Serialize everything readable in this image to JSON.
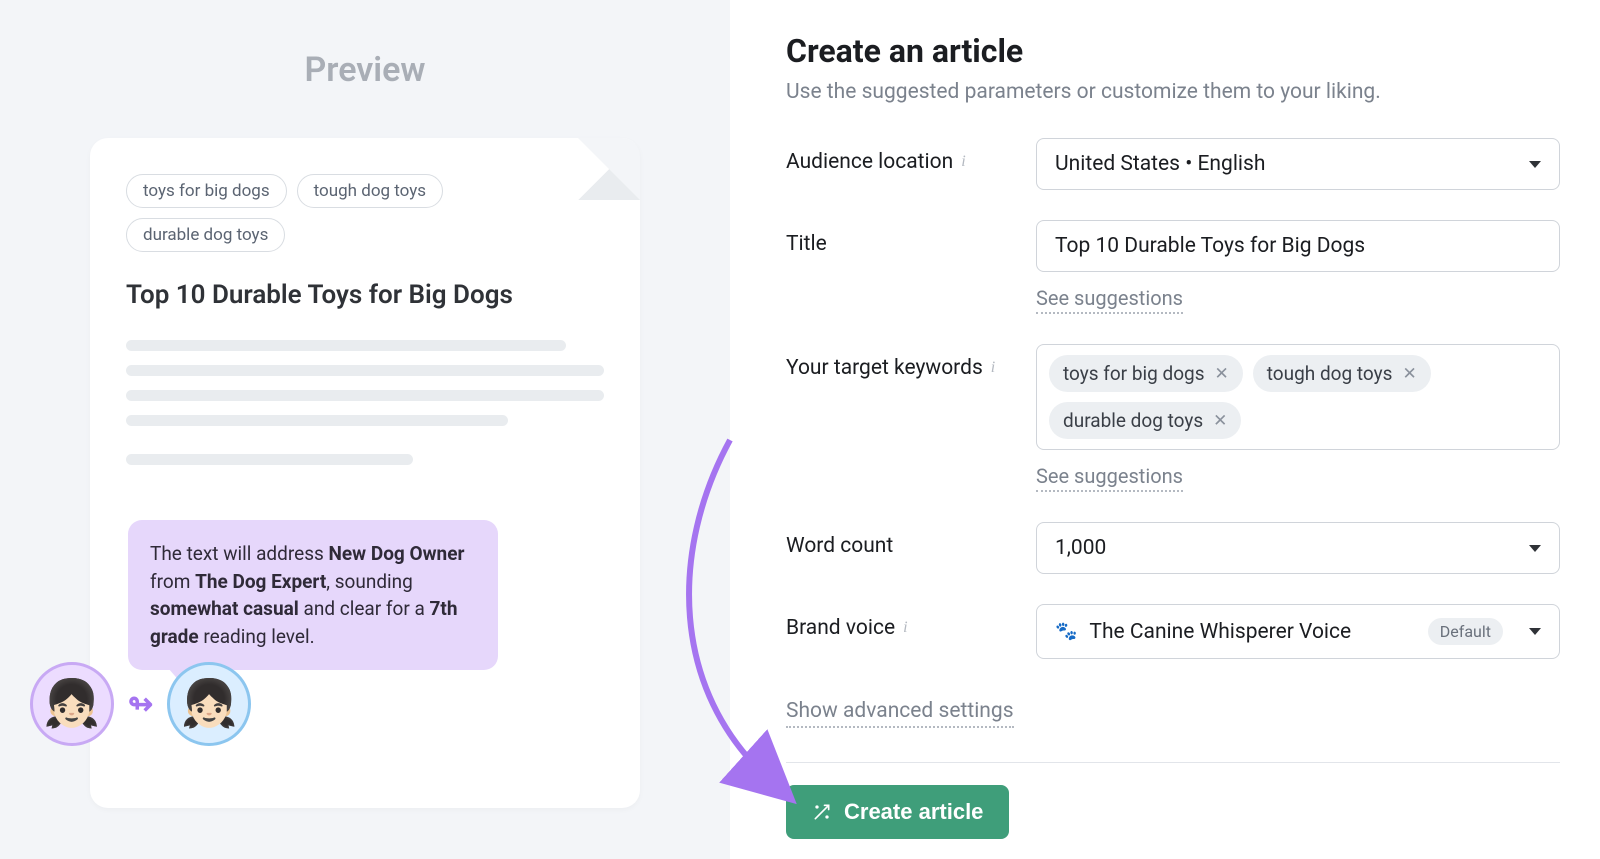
{
  "preview": {
    "heading": "Preview",
    "tags": [
      "toys for big dogs",
      "tough dog toys",
      "durable dog toys"
    ],
    "article_title": "Top 10 Durable Toys for Big Dogs",
    "tooltip": {
      "pre": "The text will address ",
      "persona": "New Dog Owner",
      "mid1": " from ",
      "brand": "The Dog Expert",
      "mid2": ", sounding ",
      "tone": "somewhat casual",
      "mid3": " and clear for a ",
      "grade": "7th grade",
      "post": " reading level."
    }
  },
  "form": {
    "heading": "Create an article",
    "subheading": "Use the suggested parameters or customize them to your liking.",
    "labels": {
      "audience": "Audience location",
      "title": "Title",
      "keywords": "Your target keywords",
      "wordcount": "Word count",
      "brand": "Brand voice"
    },
    "audience_value": "United States • English",
    "title_value": "Top 10 Durable Toys for Big Dogs",
    "title_suggestions": "See suggestions",
    "keywords": [
      "toys for big dogs",
      "tough dog toys",
      "durable dog toys"
    ],
    "keywords_suggestions": "See suggestions",
    "wordcount_value": "1,000",
    "brand_value": "The Canine Whisperer Voice",
    "brand_badge": "Default",
    "advanced": "Show advanced settings",
    "create_button": "Create article"
  }
}
